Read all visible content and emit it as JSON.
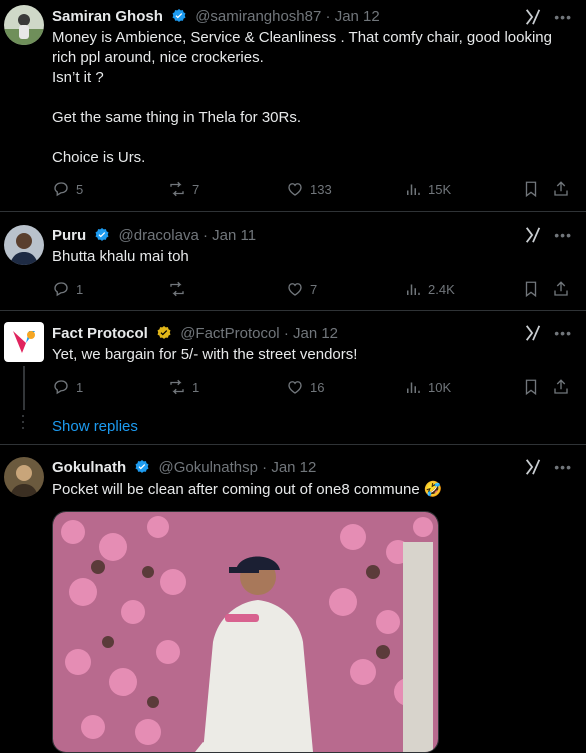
{
  "tweets": [
    {
      "name": "Samiran Ghosh",
      "handle": "@samiranghosh87",
      "date": "Jan 12",
      "verified": "blue",
      "lines": [
        "Money is Ambience, Service & Cleanliness . That comfy chair, good looking",
        "rich ppl around, nice crockeries.",
        "Isn’t it ?",
        "",
        "Get the same thing in Thela for 30Rs.",
        "",
        "Choice is Urs."
      ],
      "replies": "5",
      "reposts": "7",
      "likes": "133",
      "views": "15K"
    },
    {
      "name": "Puru",
      "handle": "@dracolava",
      "date": "Jan 11",
      "verified": "blue",
      "lines": [
        "Bhutta khalu mai toh"
      ],
      "replies": "1",
      "reposts": "",
      "likes": "7",
      "views": "2.4K"
    },
    {
      "name": "Fact Protocol",
      "handle": "@FactProtocol",
      "date": "Jan 12",
      "verified": "gold",
      "lines": [
        "Yet, we bargain for 5/- with the street vendors!"
      ],
      "replies": "1",
      "reposts": "1",
      "likes": "16",
      "views": "10K"
    },
    {
      "name": "Gokulnath",
      "handle": "@Gokulnathsp",
      "date": "Jan 12",
      "verified": "blue",
      "lines": [
        "Pocket will be clean after coming out of one8 commune 🤣"
      ]
    }
  ],
  "show_replies": "Show replies",
  "more_glyph": "•••",
  "colors": {
    "background": "#000000",
    "text": "#e7e9ea",
    "muted": "#71767b",
    "link": "#1d9bf0",
    "verified_blue": "#1d9bf0",
    "verified_gold": "#e2b719"
  }
}
